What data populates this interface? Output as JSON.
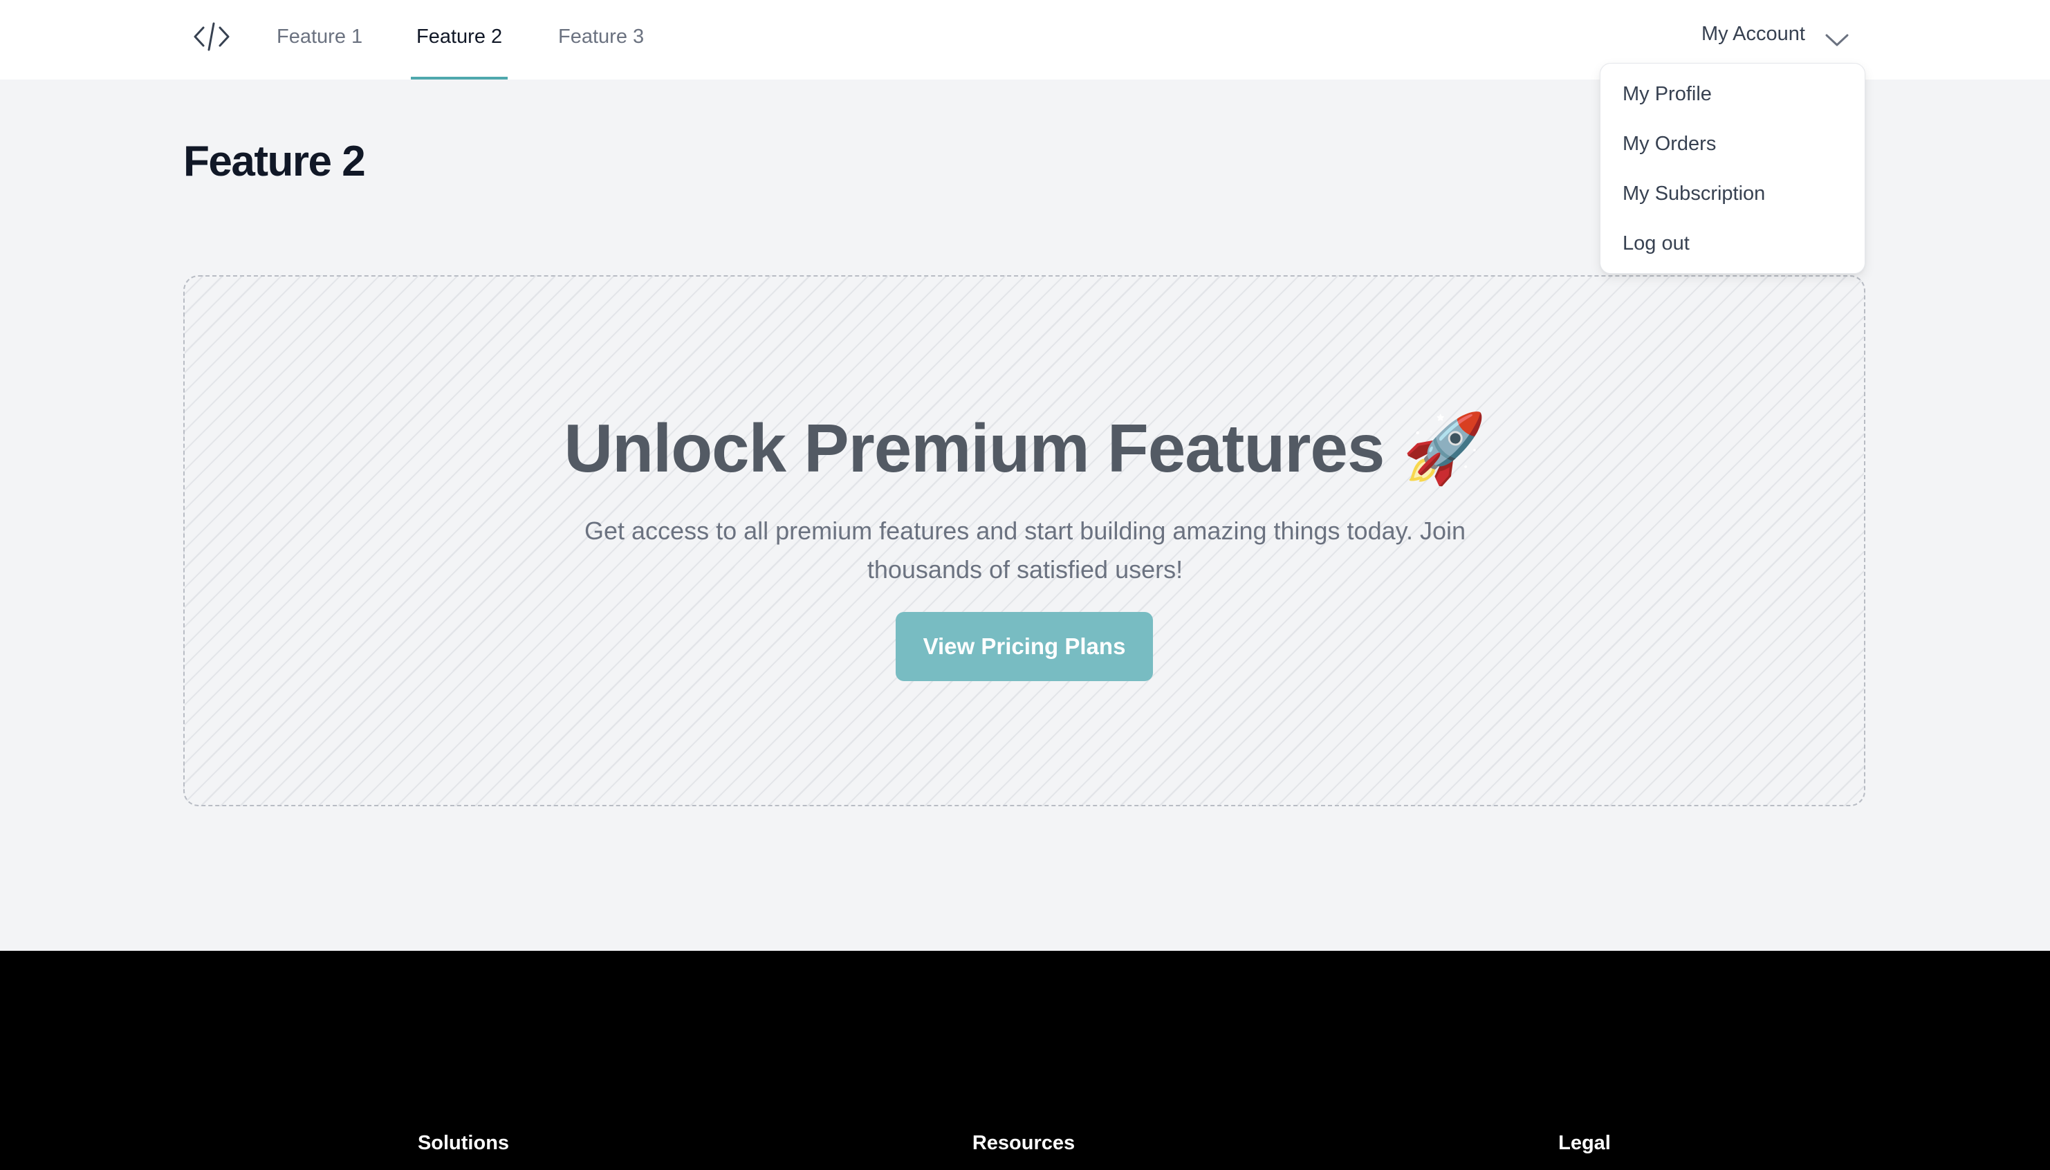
{
  "header": {
    "logo_icon": "code-brackets-icon",
    "tabs": [
      {
        "label": "Feature 1",
        "active": false
      },
      {
        "label": "Feature 2",
        "active": true
      },
      {
        "label": "Feature 3",
        "active": false
      }
    ],
    "account": {
      "label": "My Account",
      "icon": "chevron-down-icon",
      "expanded": true
    }
  },
  "account_menu": {
    "items": [
      {
        "label": "My Profile"
      },
      {
        "label": "My Orders"
      },
      {
        "label": "My Subscription"
      },
      {
        "label": "Log out"
      }
    ]
  },
  "main": {
    "page_title": "Feature 2",
    "promo": {
      "title": "Unlock Premium Features 🚀",
      "subtitle": "Get access to all premium features and start building amazing things today. Join thousands of satisfied users!",
      "cta_label": "View Pricing Plans"
    }
  },
  "footer": {
    "columns": [
      {
        "heading": "Solutions"
      },
      {
        "heading": "Resources"
      },
      {
        "heading": "Legal"
      }
    ]
  },
  "colors": {
    "accent": "#4fa8ad",
    "cta_background": "#78bcc2",
    "page_background": "#f3f4f6",
    "footer_background": "#000000"
  }
}
